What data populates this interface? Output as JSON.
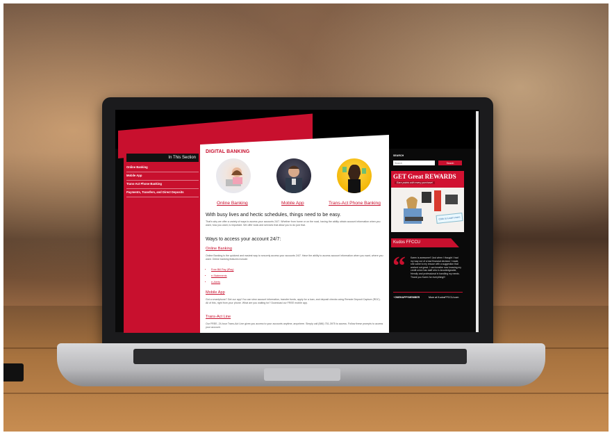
{
  "sidebar": {
    "heading": "In This Section",
    "items": [
      {
        "label": "Online Banking"
      },
      {
        "label": "Mobile App"
      },
      {
        "label": "Trans-Act Phone Banking"
      },
      {
        "label": "Payments, Transfers, and Direct Deposits"
      }
    ]
  },
  "main": {
    "title": "DIGITAL BANKING",
    "features": [
      {
        "label": "Online Banking"
      },
      {
        "label": "Mobile App"
      },
      {
        "label": "Trans-Act Phone Banking"
      }
    ],
    "lead": "With busy lives and hectic schedules, things need to be easy.",
    "intro": "That's why we offer a variety of ways to access your accounts 24/7. Whether from home or on the road, having the ability obtain account information when you want, how you want, is important. We offer tools and services that allow you to do just that.",
    "ways_heading": "Ways to access your account 24/7:",
    "online": {
      "heading": "Online Banking",
      "text": "Online Banking is the quickest and easiest way to securely access your accounts 24/7. Have the ability to access account information when you want, where you want. Online banking features include:",
      "bullets": [
        "Free Bill Pay (iPay)",
        "e-Statements",
        "e-Alerts"
      ]
    },
    "mobile": {
      "heading": "Mobile App",
      "text": "Got a smartphone? Get our app! You can view account information, transfer funds, apply for a loan, and deposit checks using Remote Deposit Capture (RDC). All of this, right from your phone. What are you waiting for? Download our FREE mobile app."
    },
    "transact": {
      "heading": "Trans-Act Line",
      "text": "Our FREE, 24-hour Trans-Act Line gives you access to your accounts anytime, anywhere. Simply call (586) 751-3975 to access. Follow these prompts to access your account."
    }
  },
  "right": {
    "search_label": "SEARCH",
    "search_placeholder": "Search",
    "search_button": "Search",
    "promo_title": "GET Great REWARDS",
    "promo_sub": "Earn points with every purchase!",
    "promo_button": "Click to Learn more",
    "kudos_tab": "Kudos FFCCU",
    "quote": "Karen is awesome!! Just when I thought I had my way out of a bad financial decision I made, she came to my rescue with a suggestion that worked out great. I can breathe now knowing my credit union has staff who is knowledgeable, friendly and professional in handling my needs. Thank you Karen for everything!!!",
    "member": "~ONEHAPPYMEMBER",
    "more": "More at KudosFFCCU.com"
  },
  "colors": {
    "brand_red": "#c8102e",
    "dark": "#0a0a0a"
  }
}
